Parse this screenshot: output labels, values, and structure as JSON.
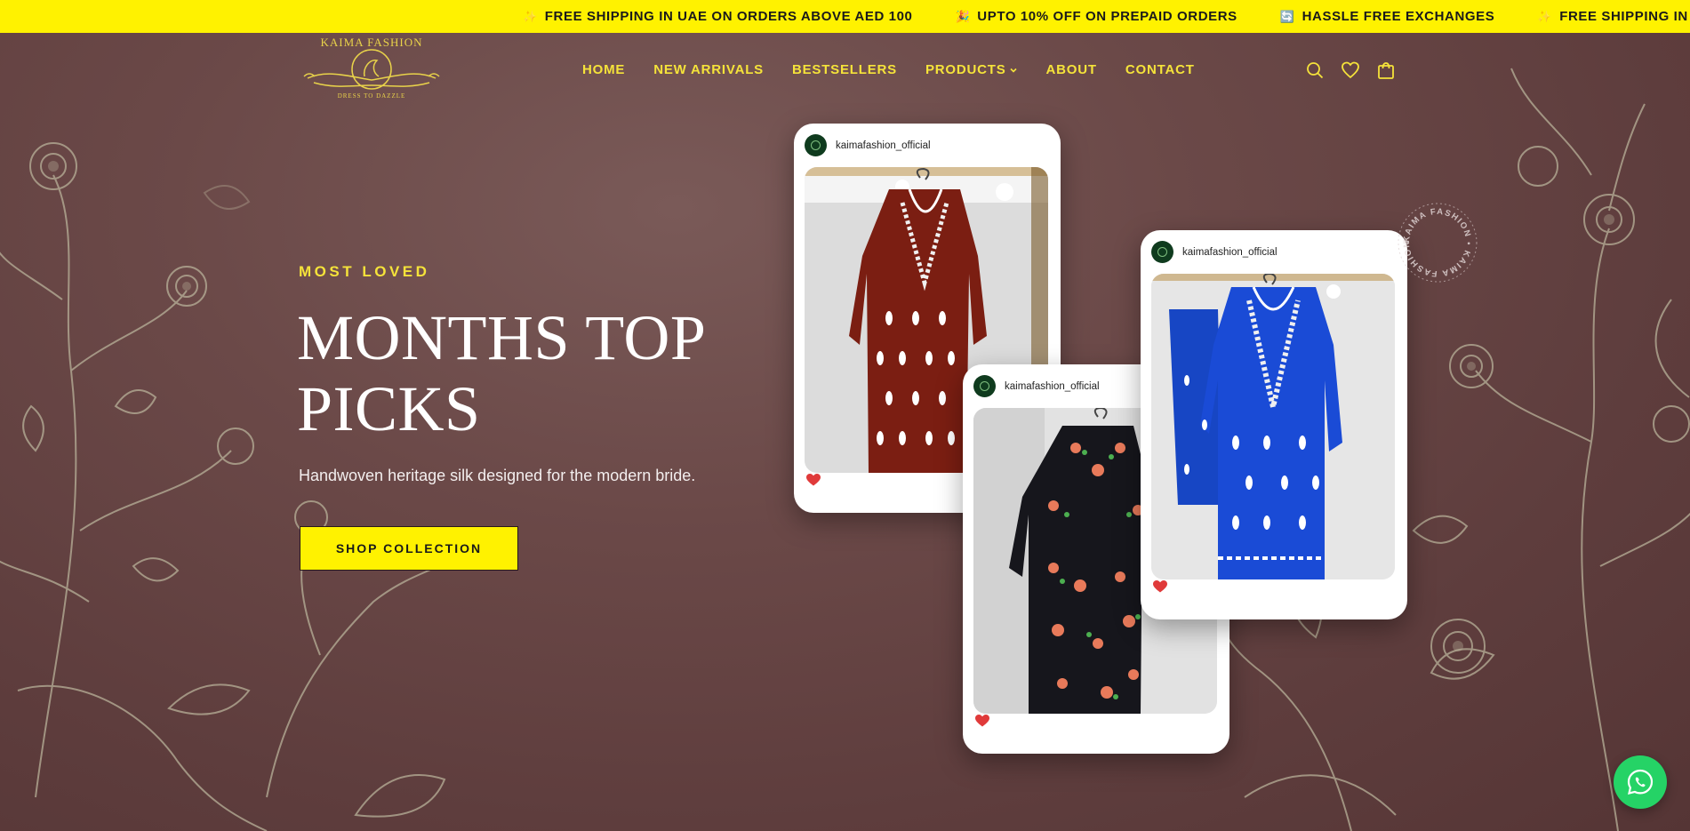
{
  "promo": {
    "items": [
      {
        "icon": "sparkle-icon",
        "text": "FREE SHIPPING IN UAE ON ORDERS ABOVE AED 100"
      },
      {
        "icon": "party-icon",
        "text": "UPTO 10% OFF ON PREPAID ORDERS"
      },
      {
        "icon": "exchange-icon",
        "text": "HASSLE FREE EXCHANGES"
      },
      {
        "icon": "sparkle-icon",
        "text": "FREE SHIPPING IN UAE ON"
      }
    ]
  },
  "header": {
    "logo_text": "KAIMA FASHION",
    "logo_subtext": "DRESS TO DAZZLE",
    "nav": [
      "HOME",
      "NEW ARRIVALS",
      "BESTSELLERS",
      "PRODUCTS",
      "ABOUT",
      "CONTACT"
    ],
    "icons": [
      "search-icon",
      "heart-icon",
      "bag-icon"
    ]
  },
  "hero": {
    "eyebrow": "MOST LOVED",
    "title_line1": "MONTHS TOP",
    "title_line2": "PICKS",
    "subtitle": "Handwoven heritage silk designed for the modern bride.",
    "cta": "SHOP COLLECTION"
  },
  "cards": [
    {
      "handle": "kaimafashion_official",
      "garment": "maroon kurta with white chikankari embroidery"
    },
    {
      "handle": "kaimafashion_official",
      "garment": "black kurta with floral embroidery"
    },
    {
      "handle": "kaimafashion_official",
      "garment": "royal blue kurta set with white embroidery"
    }
  ],
  "stamp_text": "KAIMA FASHION • KAIMA FASHION •",
  "colors": {
    "accent": "#fff200",
    "nav_text": "#f5e33a",
    "background": "#6b4948",
    "whatsapp": "#25d366",
    "heart": "#e03a3a"
  }
}
